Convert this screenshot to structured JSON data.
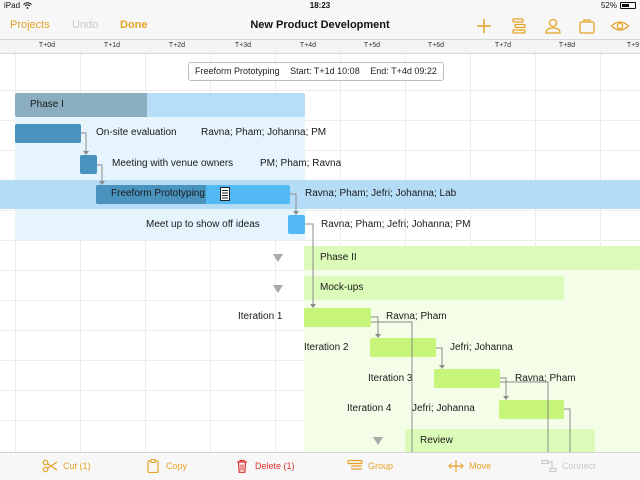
{
  "status_bar": {
    "device": "iPad",
    "wifi_icon": "wifi-icon",
    "time": "18:23",
    "battery": "52%"
  },
  "toolbar": {
    "projects": "Projects",
    "undo": "Undo",
    "done": "Done",
    "title": "New Product Development",
    "icons": [
      "add-icon",
      "outline-icon",
      "resource-icon",
      "inspector-icon",
      "view-icon"
    ]
  },
  "timeline": {
    "ticks": [
      "T+0d",
      "T+1d",
      "T+2d",
      "T+3d",
      "T+4d",
      "T+5d",
      "T+6d",
      "T+7d",
      "T+8d",
      "T+9"
    ]
  },
  "info_box": {
    "task": "Freeform Prototyping",
    "start": "Start: T+1d 10:08",
    "end": "End: T+4d 09:22"
  },
  "tasks": {
    "phase1": "Phase I",
    "onsite": "On-site evaluation",
    "onsite_res": "Ravna; Pham; Johanna; PM",
    "meeting": "Meeting with venue owners",
    "meeting_res": "PM; Pham; Ravna",
    "freeform": "Freeform Prototyping",
    "freeform_res": "Ravna; Pham; Jefri; Johanna; Lab",
    "meetup": "Meet up to show off ideas",
    "meetup_res": "Ravna; Pham; Jefri; Johanna; PM",
    "phase2": "Phase II",
    "mockups": "Mock-ups",
    "iter1": "Iteration 1",
    "iter1_res": "Ravna; Pham",
    "iter2": "Iteration 2",
    "iter2_res": "Jefri; Johanna",
    "iter3": "Iteration 3",
    "iter3_res": "Ravna; Pham",
    "iter4": "Iteration 4",
    "iter4_res": "Jefri; Johanna",
    "review": "Review"
  },
  "bottom_bar": {
    "cut": "Cut (1)",
    "copy": "Copy",
    "delete": "Delete (1)",
    "group": "Group",
    "move": "Move",
    "connect": "Connect"
  },
  "colors": {
    "accent": "#e5a228",
    "delete": "#e0302b",
    "phase1_bg": "#e5f4fd",
    "phase1_bar": "#b6def7",
    "task_blue": "#4a93bf",
    "selected_row": "#b5dcf7",
    "phase2_bg": "#f4fde8",
    "phase2_bar": "#dcfbb8",
    "task_green": "#c6f57a"
  }
}
